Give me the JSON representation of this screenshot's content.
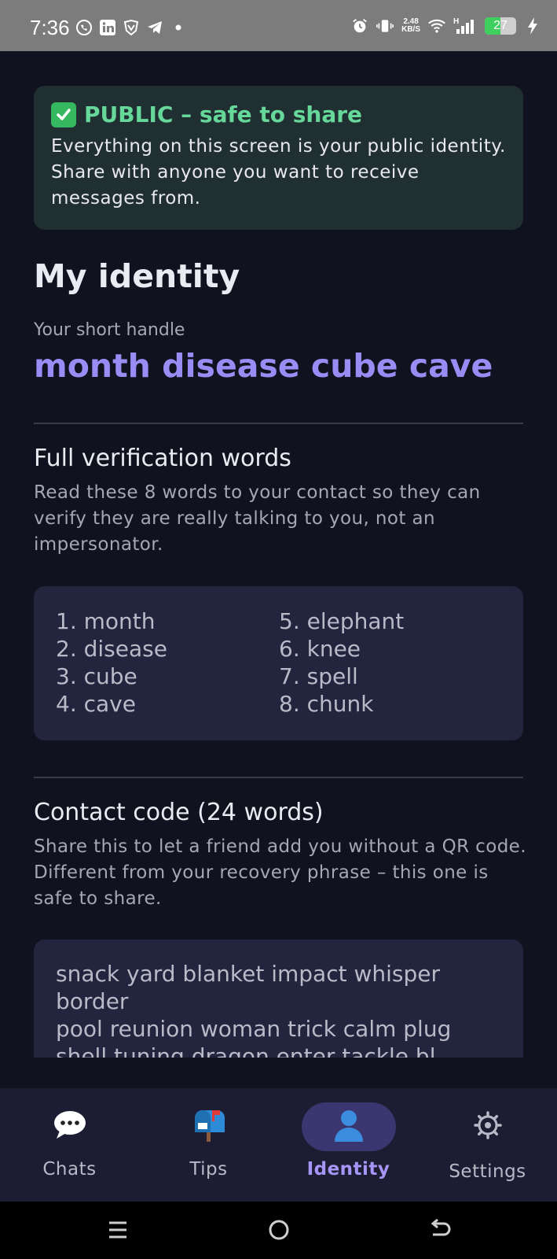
{
  "status_bar": {
    "time": "7:36",
    "speed_value": "2.48",
    "speed_unit": "KB/S",
    "network": "H",
    "battery": "27",
    "battery_level": 0.27
  },
  "banner": {
    "title": "PUBLIC – safe to share",
    "body": "Everything on this screen is your public identity. Share with anyone you want to receive messages from."
  },
  "identity": {
    "title": "My identity",
    "handle_label": "Your short handle",
    "handle": "month disease cube cave"
  },
  "verification": {
    "title": "Full verification words",
    "description": "Read these 8 words to your contact so they can verify they are really talking to you, not an impersonator.",
    "words_left": [
      "1. month",
      "2. disease",
      "3. cube",
      "4. cave"
    ],
    "words_right": [
      "5. elephant",
      "6. knee",
      "7. spell",
      "8. chunk"
    ]
  },
  "contact_code": {
    "title": "Contact code (24 words)",
    "description": "Share this to let a friend add you without a QR code. Different from your recovery phrase – this one is safe to share.",
    "lines": [
      "snack yard blanket impact whisper",
      "border",
      "pool reunion woman trick calm plug",
      "shell tuning dragon enter tackle bl"
    ]
  },
  "nav": {
    "items": [
      {
        "label": "Chats",
        "icon": "speech-bubble-icon"
      },
      {
        "label": "Tips",
        "icon": "mailbox-icon"
      },
      {
        "label": "Identity",
        "icon": "person-icon"
      },
      {
        "label": "Settings",
        "icon": "gear-icon"
      }
    ],
    "active": "Identity"
  },
  "colors": {
    "background": "#11121f",
    "accent": "#9b8cf5",
    "public_green": "#66d89a",
    "card": "#23243d"
  }
}
